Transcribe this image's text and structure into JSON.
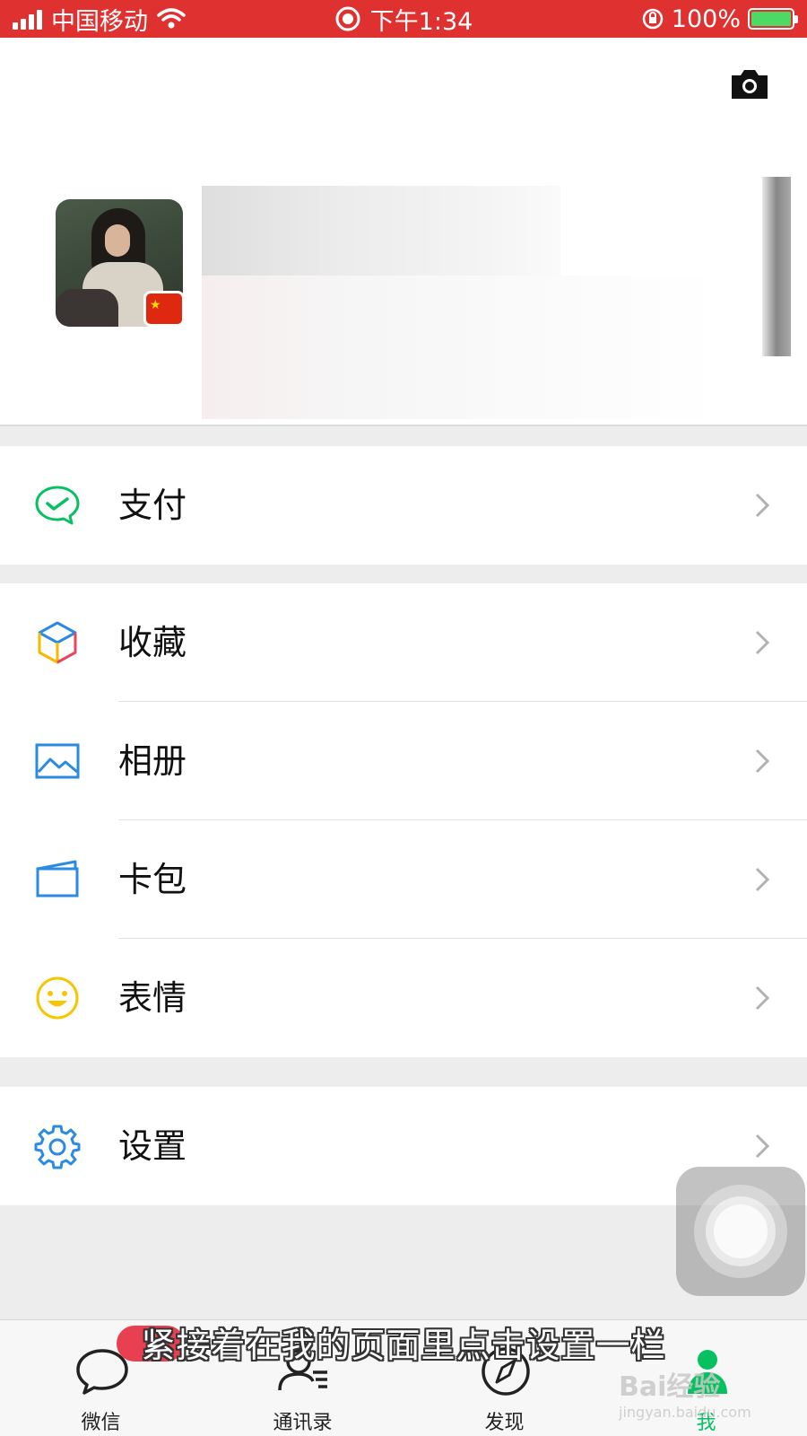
{
  "status_bar": {
    "carrier": "中国移动",
    "time": "下午1:34",
    "battery_percent": "100%",
    "icons": [
      "signal-icon",
      "wifi-icon",
      "record-icon",
      "rotation-lock-icon",
      "battery-charging-icon"
    ]
  },
  "profile": {
    "camera_icon": "camera-icon",
    "avatar_badge": "china-flag-icon"
  },
  "menu": {
    "pay": {
      "label": "支付",
      "icon": "wechat-pay-icon"
    },
    "favorites": {
      "label": "收藏",
      "icon": "cube-icon"
    },
    "album": {
      "label": "相册",
      "icon": "picture-icon"
    },
    "cards": {
      "label": "卡包",
      "icon": "card-wallet-icon"
    },
    "stickers": {
      "label": "表情",
      "icon": "smiley-icon"
    },
    "settings": {
      "label": "设置",
      "icon": "gear-icon"
    }
  },
  "tabbar": {
    "chats": "微信",
    "contacts": "通讯录",
    "discover": "发现",
    "me": "我"
  },
  "overlay": {
    "subtitle": "紧接着在我的页面里点击设置一栏",
    "watermark_main": "Bai经验",
    "watermark_sub": "jingyan.baidu.com"
  },
  "colors": {
    "status_bar": "#e03131",
    "accent_green": "#07c160",
    "badge_red": "#e84050"
  }
}
